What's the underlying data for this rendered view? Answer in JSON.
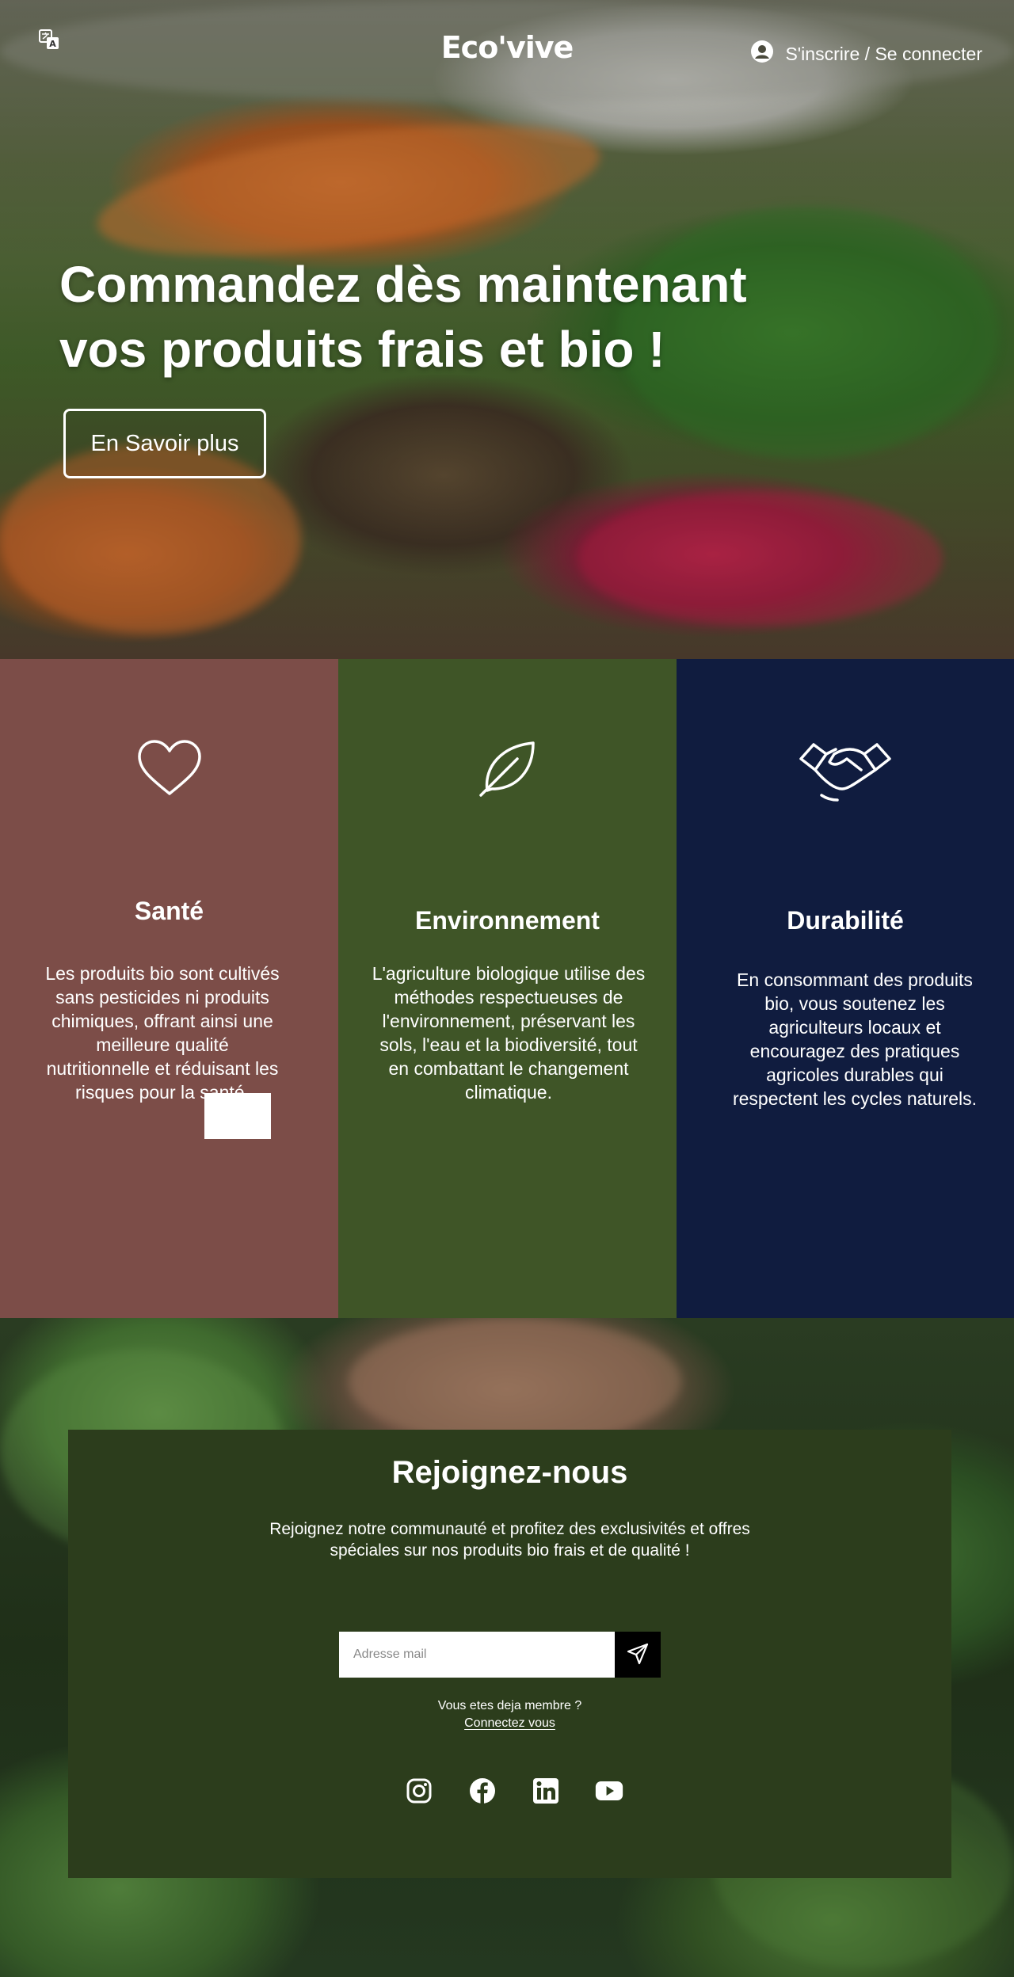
{
  "header": {
    "brand": "Eco'vive",
    "account_label": "S'inscrire / Se connecter",
    "language_icon": "translate-icon",
    "account_icon": "user-circle-icon"
  },
  "hero": {
    "title": "Commandez dès maintenant vos produits frais et bio !",
    "button_label": "En Savoir plus"
  },
  "features": [
    {
      "icon": "heart-icon",
      "title": "Santé",
      "text": "Les produits bio sont cultivés sans pesticides ni produits chimiques, offrant ainsi une meilleure qualité nutritionnelle et réduisant les risques pour la santé.",
      "color": "#7c4d48"
    },
    {
      "icon": "leaf-icon",
      "title": "Environnement",
      "text": "L'agriculture biologique utilise des méthodes respectueuses de l'environnement, préservant les sols, l'eau et la biodiversité, tout en combattant le changement climatique.",
      "color": "#3f5527"
    },
    {
      "icon": "handshake-icon",
      "title": "Durabilité",
      "text": "En consommant des produits bio, vous soutenez les agriculteurs locaux et encouragez des pratiques agricoles durables qui respectent les cycles naturels.",
      "color": "#101c3f"
    }
  ],
  "join": {
    "title": "Rejoignez-nous",
    "text": "Rejoignez notre communauté et profitez des exclusivités et offres spéciales sur nos produits bio frais et de qualité !",
    "email_placeholder": "Adresse mail",
    "send_icon": "send-icon",
    "member_question": "Vous etes deja membre ?",
    "member_link": "Connectez vous",
    "panel_color": "#2c3d1c",
    "socials": [
      "instagram-icon",
      "facebook-icon",
      "linkedin-icon",
      "youtube-icon"
    ]
  }
}
